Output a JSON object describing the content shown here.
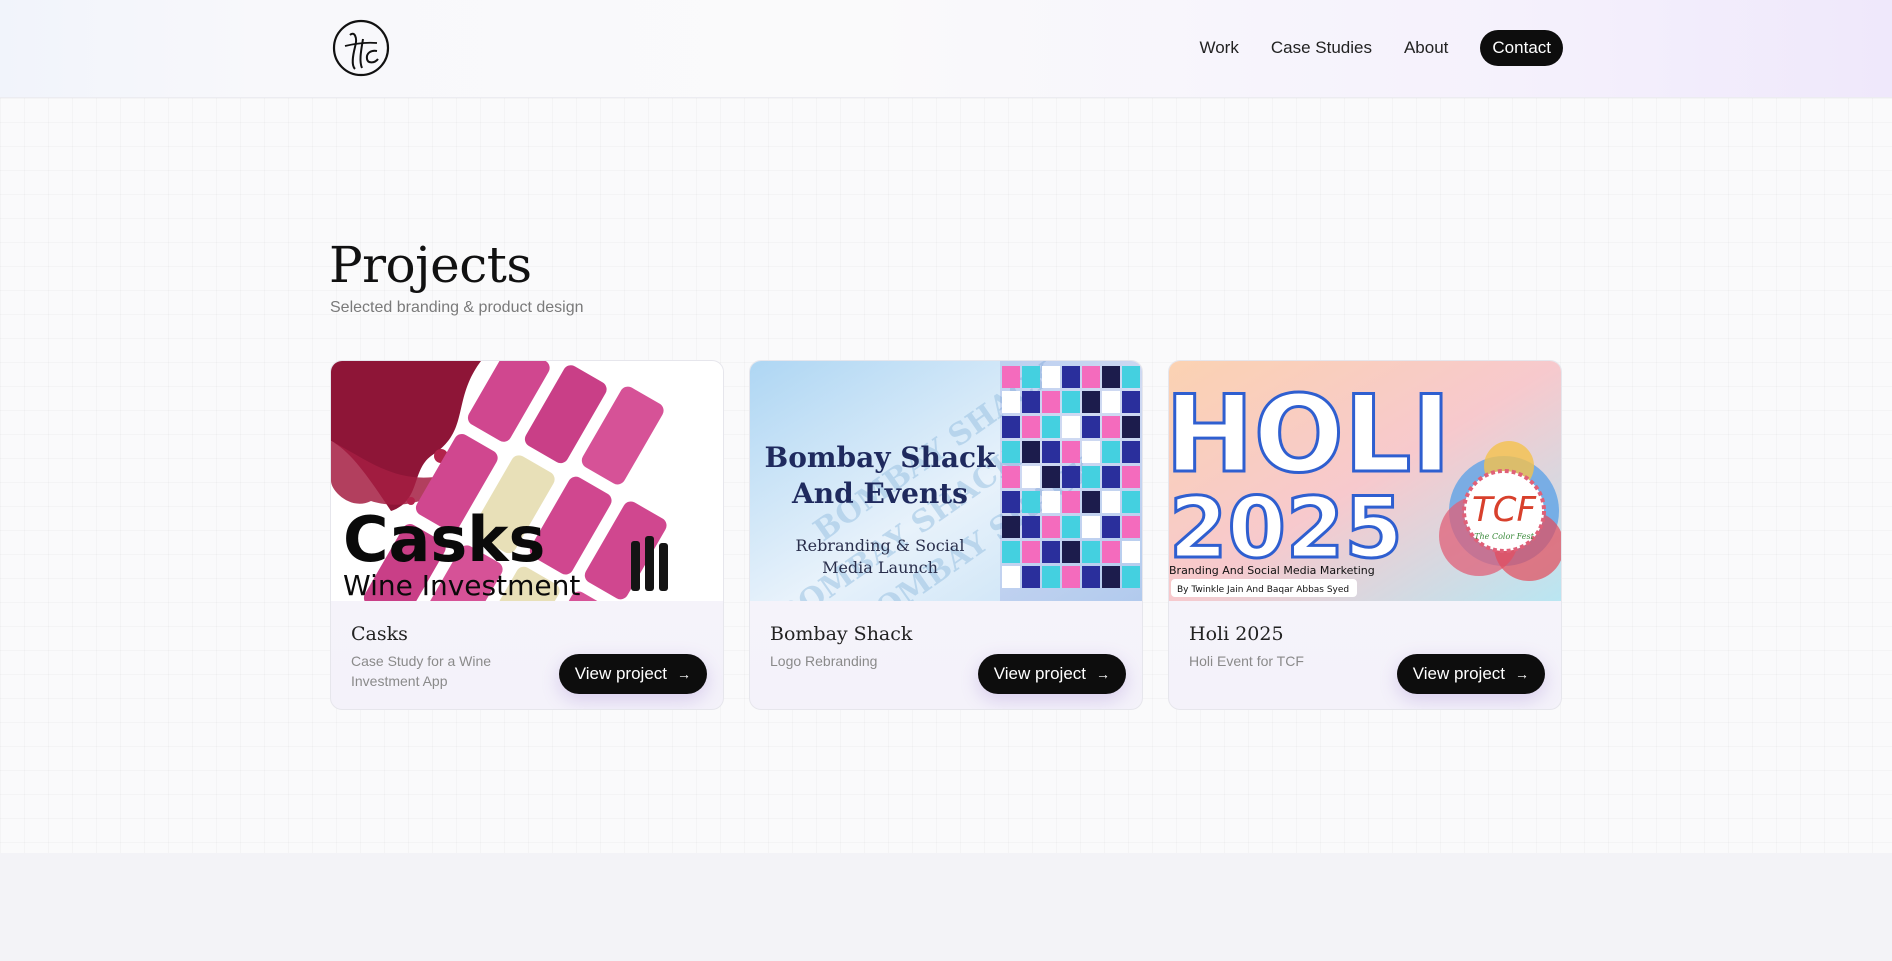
{
  "nav": {
    "links": [
      "Work",
      "Case Studies",
      "About"
    ],
    "contact_label": "Contact"
  },
  "projects": {
    "title": "Projects",
    "subtitle": "Selected branding & product design"
  },
  "cards": [
    {
      "title": "Casks",
      "desc": "Case Study for a Wine Investment App",
      "button": "View project",
      "thumb_text": {
        "big": "Casks",
        "small": "Wine Investment"
      }
    },
    {
      "title": "Bombay Shack",
      "desc": "Logo Rebranding",
      "button": "View project",
      "thumb_text": {
        "line1": "Bombay Shack",
        "line2": "And Events",
        "line3": "Rebranding & Social",
        "line4": "Media Launch",
        "watermark": "BOMBAY SHACK"
      }
    },
    {
      "title": "Holi 2025",
      "desc": "Holi Event for TCF",
      "button": "View project",
      "thumb_text": {
        "big1": "HOLI",
        "big2": "2025",
        "caption": "Branding And Social Media Marketing",
        "credit": "By Twinkle Jain And Baqar Abbas Syed",
        "badge": "TCF",
        "badge_sub": "The Color Fest"
      }
    }
  ],
  "colors": {
    "accent_dark": "#0d0d0d",
    "casks_pink": "#d0478f",
    "bombay_navy": "#1f2a5e",
    "holi_blue": "#2f5fd0"
  },
  "icons": {
    "arrow": "arrow-right-icon"
  }
}
